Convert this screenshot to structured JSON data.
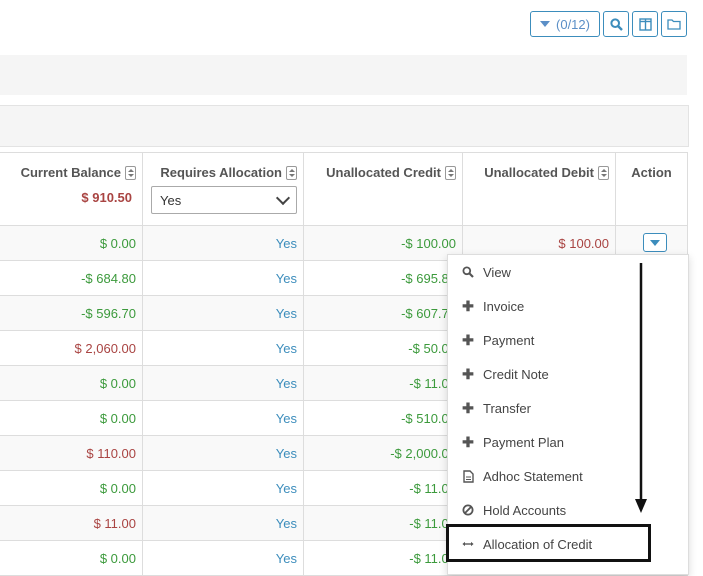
{
  "toolbar": {
    "filter_label": "(0/12)"
  },
  "table": {
    "columns": {
      "current_balance": "Current Balance",
      "requires_allocation": "Requires Allocation",
      "unallocated_credit": "Unallocated Credit",
      "unallocated_debit": "Unallocated Debit",
      "action": "Action"
    },
    "total_balance": "$ 910.50",
    "filter_value": "Yes",
    "rows": [
      {
        "balance": "$ 0.00",
        "req": "Yes",
        "credit": "-$ 100.00",
        "debit": "$ 100.00"
      },
      {
        "balance": "-$ 684.80",
        "req": "Yes",
        "credit": "-$ 695.80",
        "debit": ""
      },
      {
        "balance": "-$ 596.70",
        "req": "Yes",
        "credit": "-$ 607.70",
        "debit": ""
      },
      {
        "balance": "$ 2,060.00",
        "req": "Yes",
        "credit": "-$ 50.00",
        "debit": ""
      },
      {
        "balance": "$ 0.00",
        "req": "Yes",
        "credit": "-$ 11.00",
        "debit": ""
      },
      {
        "balance": "$ 0.00",
        "req": "Yes",
        "credit": "-$ 510.00",
        "debit": ""
      },
      {
        "balance": "$ 110.00",
        "req": "Yes",
        "credit": "-$ 2,000.00",
        "debit": ""
      },
      {
        "balance": "$ 0.00",
        "req": "Yes",
        "credit": "-$ 11.00",
        "debit": ""
      },
      {
        "balance": "$ 11.00",
        "req": "Yes",
        "credit": "-$ 11.00",
        "debit": ""
      },
      {
        "balance": "$ 0.00",
        "req": "Yes",
        "credit": "-$ 11.00",
        "debit": ""
      }
    ]
  },
  "menu": {
    "items": [
      {
        "label": "View",
        "icon": "search-icon"
      },
      {
        "label": "Invoice",
        "icon": "plus-icon"
      },
      {
        "label": "Payment",
        "icon": "plus-icon"
      },
      {
        "label": "Credit Note",
        "icon": "plus-icon"
      },
      {
        "label": "Transfer",
        "icon": "plus-icon"
      },
      {
        "label": "Payment Plan",
        "icon": "plus-icon"
      },
      {
        "label": "Adhoc Statement",
        "icon": "document-icon"
      },
      {
        "label": "Hold Accounts",
        "icon": "ban-icon"
      },
      {
        "label": "Allocation of Credit",
        "icon": "arrows-horizontal-icon"
      }
    ]
  },
  "colors": {
    "accent": "#3c8dbc",
    "positive": "#3c9a3c",
    "negative": "#a94442"
  }
}
